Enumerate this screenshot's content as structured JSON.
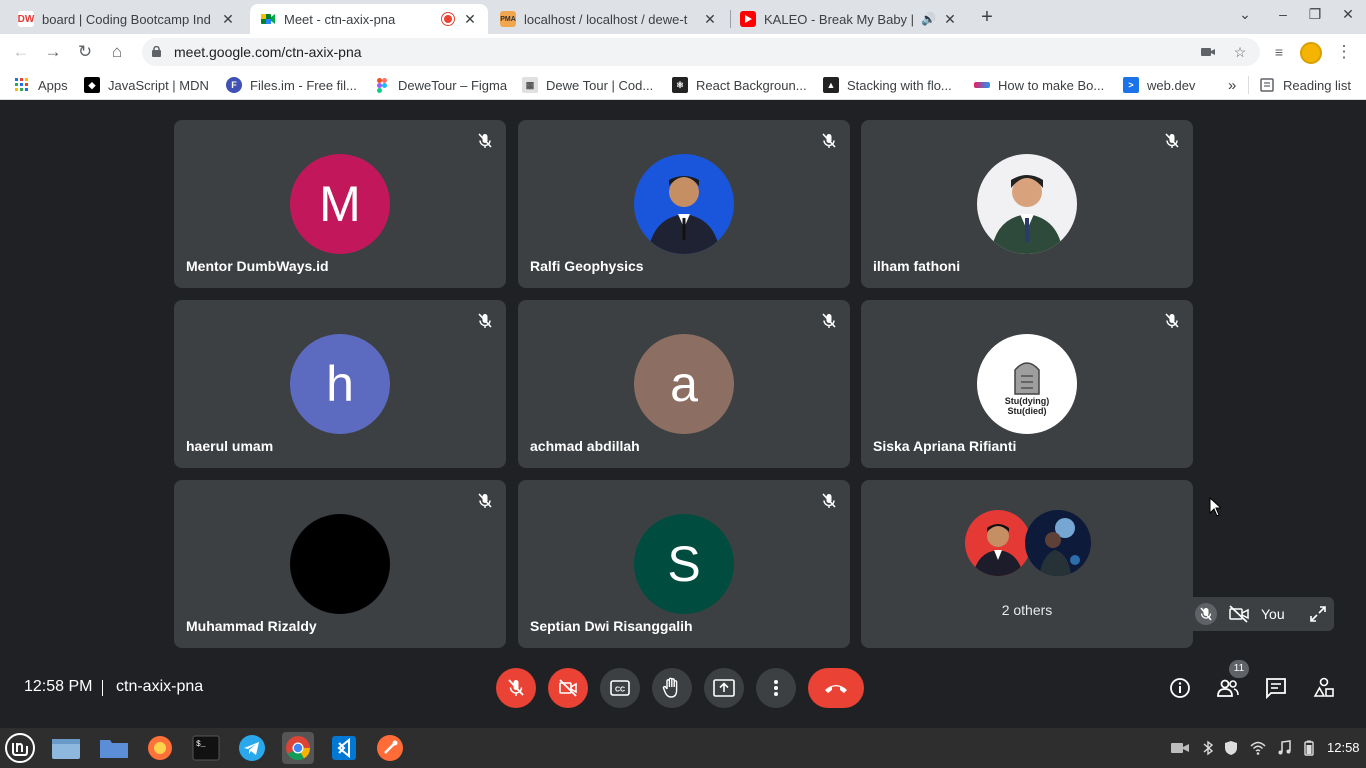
{
  "browser": {
    "tabs": [
      {
        "title": "board | Coding Bootcamp Ind",
        "favicon": "dumbways-icon",
        "active": false
      },
      {
        "title": "Meet - ctn-axix-pna",
        "favicon": "meet-icon",
        "active": true,
        "recording": true
      },
      {
        "title": "localhost / localhost / dewe-t",
        "favicon": "phpmyadmin-icon",
        "active": false
      },
      {
        "title": "KALEO - Break My Baby | P",
        "favicon": "youtube-icon",
        "active": false,
        "audio": true
      }
    ],
    "url": "meet.google.com/ctn-axix-pna",
    "bookmarks": [
      {
        "label": "Apps",
        "icon": "apps-grid-icon"
      },
      {
        "label": "JavaScript | MDN",
        "icon": "mdn-icon"
      },
      {
        "label": "Files.im - Free fil...",
        "icon": "filesim-icon"
      },
      {
        "label": "DeweTour – Figma",
        "icon": "figma-icon"
      },
      {
        "label": "Dewe Tour | Cod...",
        "icon": "dewetour-icon"
      },
      {
        "label": "React Backgroun...",
        "icon": "react-icon"
      },
      {
        "label": "Stacking with flo...",
        "icon": "stacking-icon"
      },
      {
        "label": "How to make Bo...",
        "icon": "howto-icon"
      },
      {
        "label": "web.dev",
        "icon": "webdev-icon"
      }
    ],
    "more_bookmarks": "»",
    "reading_list": "Reading list"
  },
  "meet": {
    "participants": [
      {
        "name": "Mentor DumbWays.id",
        "initial": "M",
        "color": "#c2185b",
        "muted": true
      },
      {
        "name": "Ralfi Geophysics",
        "initial": "",
        "photo": "photo-blue",
        "muted": true
      },
      {
        "name": "ilham fathoni",
        "initial": "",
        "photo": "photo-white",
        "muted": true
      },
      {
        "name": "haerul umam",
        "initial": "h",
        "color": "#5c6bc0",
        "muted": true
      },
      {
        "name": "achmad abdillah",
        "initial": "a",
        "color": "#8d6e63",
        "muted": true
      },
      {
        "name": "Siska Apriana Rifianti",
        "initial": "",
        "photo": "photo-studying",
        "muted": true
      },
      {
        "name": "Muhammad Rizaldy",
        "initial": "",
        "color": "#000000",
        "muted": true
      },
      {
        "name": "Septian Dwi Risanggalih",
        "initial": "S",
        "color": "#004d40",
        "muted": true
      }
    ],
    "others_label": "2 others",
    "studying_text": {
      "line1": "Stu(dying)",
      "line2": "Stu(died)"
    },
    "self_label": "You",
    "time": "12:58 PM",
    "meeting_code": "ctn-axix-pna",
    "people_count": "11"
  },
  "taskbar": {
    "time": "12:58"
  }
}
